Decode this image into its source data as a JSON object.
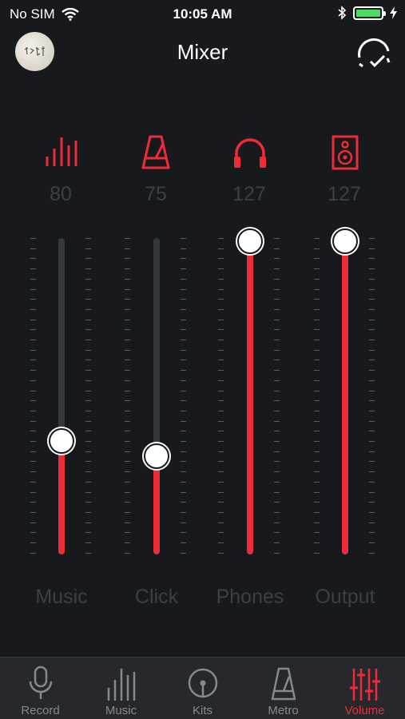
{
  "status_bar": {
    "carrier": "No SIM",
    "time": "10:05 AM",
    "battery_color": "#4cd964"
  },
  "nav": {
    "title": "Mixer",
    "action_icon": "check-arc-icon"
  },
  "colors": {
    "accent": "#ee2c39",
    "background": "#17191c",
    "inactive_text": "#3c3f44",
    "tab_bar": "#26282c"
  },
  "mixer": {
    "max_level": 127,
    "channels": [
      {
        "label": "Music",
        "value": "80",
        "level": 80,
        "icon": "bars-icon"
      },
      {
        "label": "Click",
        "value": "75",
        "level": 75,
        "icon": "metronome-icon"
      },
      {
        "label": "Phones",
        "value": "127",
        "level": 127,
        "icon": "headphones-icon"
      },
      {
        "label": "Output",
        "value": "127",
        "level": 127,
        "icon": "speaker-icon"
      }
    ]
  },
  "tabs": [
    {
      "label": "Record",
      "icon": "microphone-icon",
      "active": false
    },
    {
      "label": "Music",
      "icon": "bars-icon",
      "active": false
    },
    {
      "label": "Kits",
      "icon": "drum-icon",
      "active": false
    },
    {
      "label": "Metro",
      "icon": "metronome-icon",
      "active": false
    },
    {
      "label": "Volume",
      "icon": "sliders-icon",
      "active": true
    }
  ]
}
